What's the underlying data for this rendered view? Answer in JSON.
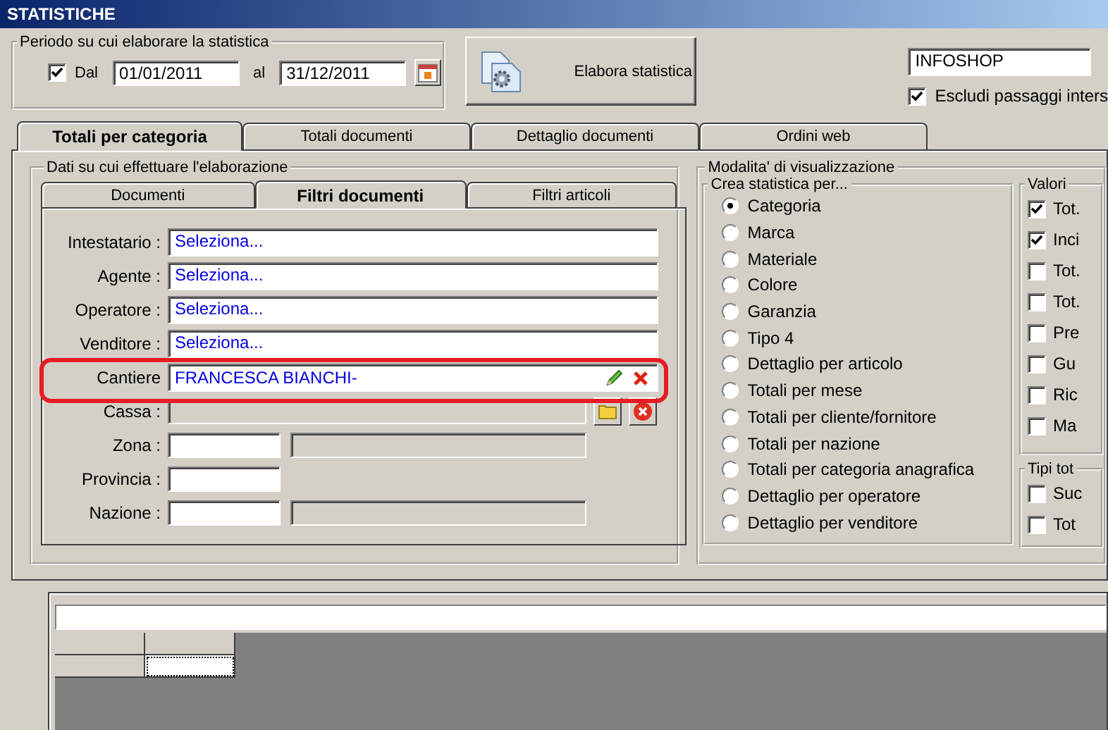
{
  "window": {
    "title": "STATISTICHE"
  },
  "period": {
    "legend": "Periodo su cui elaborare la statistica",
    "enabled": {
      "label": "Dal",
      "checked": true
    },
    "from": "01/01/2011",
    "to_label": "al",
    "to": "31/12/2011"
  },
  "run_button": {
    "label": "Elabora statistica"
  },
  "store": {
    "value": "INFOSHOP"
  },
  "exclude": {
    "label": "Escludi passaggi inters",
    "checked": true
  },
  "tabs": [
    {
      "label": "Totali per categoria",
      "selected": true
    },
    {
      "label": "Totali documenti",
      "selected": false
    },
    {
      "label": "Dettaglio documenti",
      "selected": false
    },
    {
      "label": "Ordini web",
      "selected": false
    }
  ],
  "data_group": {
    "legend": "Dati su cui effettuare l'elaborazione",
    "tabs": [
      {
        "label": "Documenti",
        "selected": false
      },
      {
        "label": "Filtri documenti",
        "selected": true
      },
      {
        "label": "Filtri articoli",
        "selected": false
      }
    ],
    "fields": [
      {
        "kind": "select",
        "label": "Intestatario :",
        "value": "Seleziona..."
      },
      {
        "kind": "select",
        "label": "Agente :",
        "value": "Seleziona..."
      },
      {
        "kind": "select",
        "label": "Operatore :",
        "value": "Seleziona..."
      },
      {
        "kind": "select",
        "label": "Venditore :",
        "value": "Seleziona..."
      },
      {
        "kind": "chosen",
        "label": "Cantiere",
        "value": "FRANCESCA BIANCHI-",
        "highlighted": true
      },
      {
        "kind": "lookup",
        "label": "Cassa :"
      },
      {
        "kind": "code-desc",
        "label": "Zona :"
      },
      {
        "kind": "code",
        "label": "Provincia :"
      },
      {
        "kind": "code-desc",
        "label": "Nazione :"
      }
    ]
  },
  "view_group": {
    "legend": "Modalita' di visualizzazione",
    "by": {
      "legend": "Crea statistica per...",
      "options": [
        {
          "label": "Categoria",
          "selected": true
        },
        {
          "label": "Marca",
          "selected": false
        },
        {
          "label": "Materiale",
          "selected": false
        },
        {
          "label": "Colore",
          "selected": false
        },
        {
          "label": "Garanzia",
          "selected": false
        },
        {
          "label": "Tipo 4",
          "selected": false
        },
        {
          "label": "Dettaglio per articolo",
          "selected": false
        },
        {
          "label": "Totali per mese",
          "selected": false
        },
        {
          "label": "Totali per cliente/fornitore",
          "selected": false
        },
        {
          "label": "Totali per nazione",
          "selected": false
        },
        {
          "label": "Totali per categoria anagrafica",
          "selected": false
        },
        {
          "label": "Dettaglio per operatore",
          "selected": false
        },
        {
          "label": "Dettaglio per venditore",
          "selected": false
        }
      ]
    },
    "values": {
      "legend": "Valori",
      "items": [
        {
          "label": "Tot.",
          "checked": true
        },
        {
          "label": "Inci",
          "checked": true
        },
        {
          "label": "Tot.",
          "checked": false
        },
        {
          "label": "Tot.",
          "checked": false
        },
        {
          "label": "Pre",
          "checked": false
        },
        {
          "label": "Gu",
          "checked": false
        },
        {
          "label": "Ric",
          "checked": false
        },
        {
          "label": "Ma",
          "checked": false
        }
      ]
    },
    "totals": {
      "legend": "Tipi tot",
      "items": [
        {
          "label": "Suc",
          "checked": false
        },
        {
          "label": "Tot",
          "checked": false
        }
      ]
    }
  }
}
